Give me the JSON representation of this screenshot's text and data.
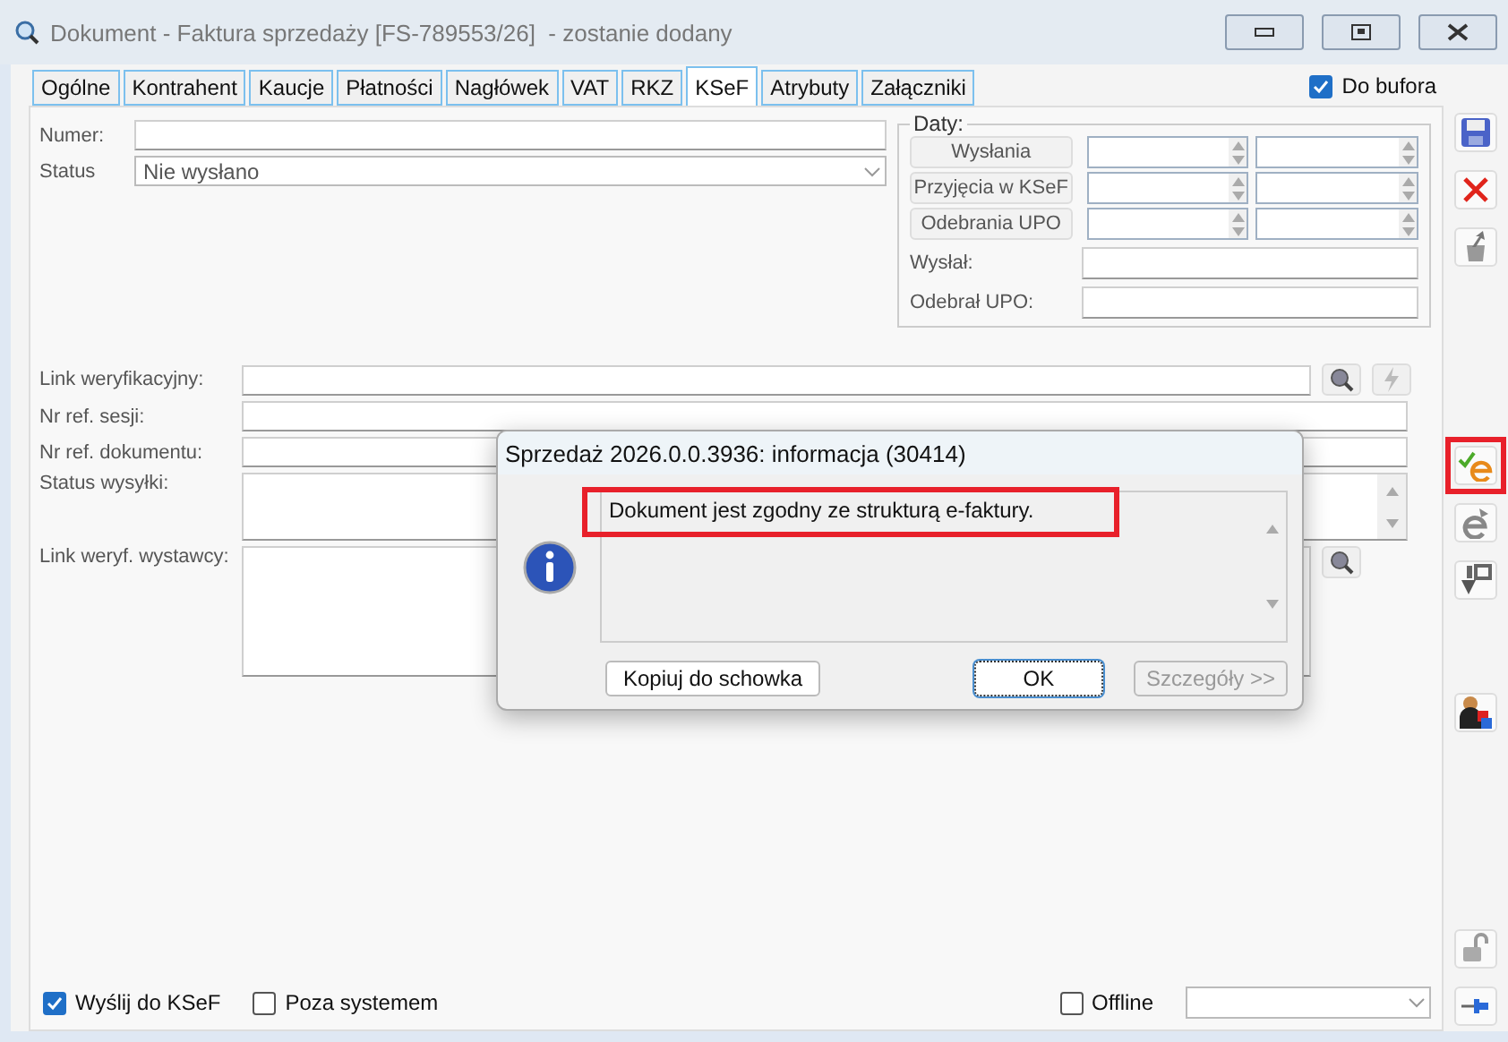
{
  "window": {
    "title": "Dokument - Faktura sprzedaży [FS-789553/26]  - zostanie dodany"
  },
  "tabs": [
    {
      "label": "Ogólne",
      "selected": false
    },
    {
      "label": "Kontrahent",
      "selected": false
    },
    {
      "label": "Kaucje",
      "selected": false
    },
    {
      "label": "Płatności",
      "selected": false
    },
    {
      "label": "Nagłówek",
      "selected": false
    },
    {
      "label": "VAT",
      "selected": false
    },
    {
      "label": "RKZ",
      "selected": false
    },
    {
      "label": "KSeF",
      "selected": true
    },
    {
      "label": "Atrybuty",
      "selected": false
    },
    {
      "label": "Załączniki",
      "selected": false
    }
  ],
  "do_bufora": {
    "label": "Do bufora",
    "checked": true
  },
  "numer": {
    "label": "Numer:"
  },
  "status": {
    "label": "Status",
    "value": "Nie wysłano"
  },
  "daty": {
    "title": "Daty:",
    "rows": [
      {
        "label": "Wysłania"
      },
      {
        "label": "Przyjęcia w KSeF"
      },
      {
        "label": "Odebrania UPO"
      }
    ],
    "people": [
      {
        "label": "Wysłał:"
      },
      {
        "label": "Odebrał UPO:"
      }
    ]
  },
  "links": [
    {
      "label": "Link weryfikacyjny:",
      "kind": "link"
    },
    {
      "label": "Nr ref. sesji:",
      "kind": "line"
    },
    {
      "label": "Nr ref. dokumentu:",
      "kind": "line"
    },
    {
      "label": "Status wysyłki:",
      "kind": "status"
    },
    {
      "label": "Link weryf. wystawcy:",
      "kind": "area"
    }
  ],
  "toolbar": [
    [
      {
        "kind": "save",
        "highlighted": false
      },
      {
        "kind": "delete",
        "highlighted": false
      },
      {
        "kind": "export",
        "highlighted": false
      }
    ],
    [
      {
        "kind": "ksef_check",
        "highlighted": true
      },
      {
        "kind": "e_send",
        "highlighted": false
      },
      {
        "kind": "upo",
        "highlighted": false
      }
    ],
    [
      {
        "kind": "person",
        "highlighted": false
      }
    ],
    [
      {
        "kind": "lock",
        "highlighted": false
      },
      {
        "kind": "pin",
        "highlighted": false
      }
    ]
  ],
  "footer": {
    "checks": [
      {
        "label": "Wyślij do KSeF",
        "checked": true
      },
      {
        "label": "Poza systemem",
        "checked": false
      }
    ],
    "offline": {
      "label": "Offline",
      "checked": false
    }
  },
  "dialog": {
    "title": "Sprzedaż 2026.0.0.3936: informacja (30414)",
    "message": "Dokument jest zgodny ze strukturą e-faktury.",
    "highlighted": true,
    "buttons": [
      {
        "label": "Kopiuj do schowka",
        "kind": "normal"
      },
      {
        "label": "OK",
        "kind": "default"
      },
      {
        "label": "Szczegóły >>",
        "kind": "disabled"
      }
    ]
  }
}
